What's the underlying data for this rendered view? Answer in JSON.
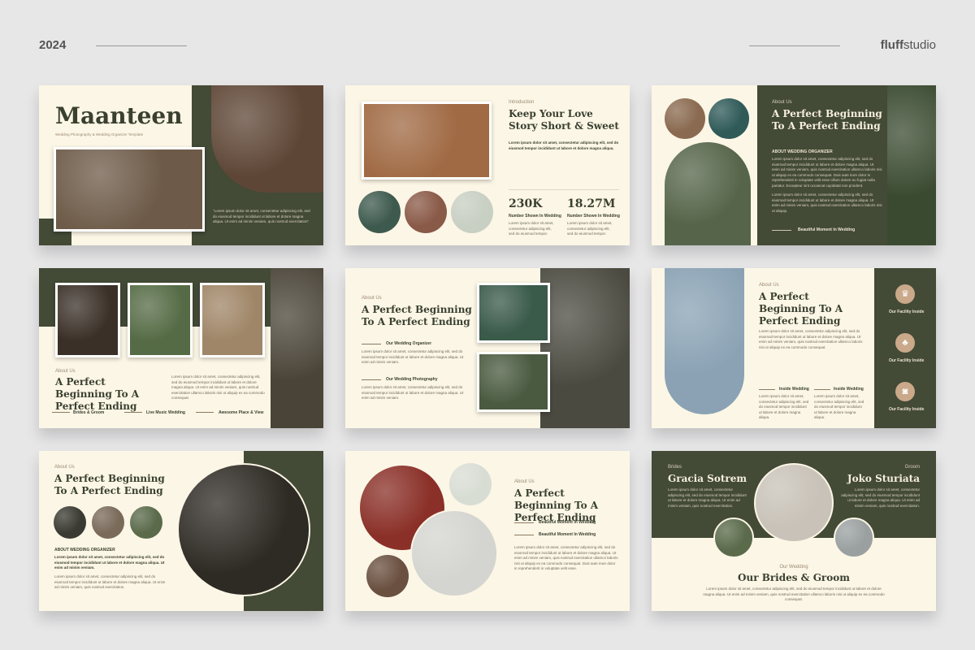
{
  "header": {
    "year": "2024",
    "brand_bold": "fluff",
    "brand_rest": "studio"
  },
  "s1": {
    "title": "Maanteen",
    "subtitle": "Wedding Photography & Wedding Organizer Template",
    "quote": "\"Lorem ipsum dolor sit amet, consectetur adipiscing elit, sed do eiusmod tempor incididunt ut labore et dolore magna aliqua. Ut enim ad minim veniam, quis nostrud exercitation\""
  },
  "s2": {
    "kicker": "Introduction",
    "title": "Keep Your Love Story Short & Sweet",
    "lead": "Lorem ipsum dolor sit amet, consectetur adipiscing elit, sed do eiusmod tempor incididunt ut labore et dolore magna aliqua.",
    "stat1_value": "230K",
    "stat1_label": "Number Shown In Wedding",
    "stat2_value": "18.27M",
    "stat2_label": "Number Shown In Wedding",
    "body": "Lorem ipsum dolor sit amet, consectetur adipiscing elit, sed do eiusmod tempor."
  },
  "s3": {
    "kicker": "About Us",
    "title": "A Perfect Beginning To A Perfect Ending",
    "section": "ABOUT WEDDING ORGANIZER",
    "body": "Lorem ipsum dolor sit amet, consectetur adipiscing elit, sed do eiusmod tempor incididunt ut labore et dolore magna aliqua. Ut enim ad minim veniam, quis nostrud exercitation ullamco laboris nisi ut aliquip ex ea commodo consequat. Duis aute irure dolor in reprehenderit in voluptate velit esse cillum dolore eu fugiat nulla pariatur. Excepteur sint occaecat cupidatat non proident.",
    "body2": "Lorem ipsum dolor sit amet, consectetur adipiscing elit, sed do eiusmod tempor incididunt ut labore et dolore magna aliqua. Ut enim ad minim veniam, quis nostrud exercitation ullamco laboris nisi ut aliquip.",
    "footer": "Beautiful Moment In Wedding"
  },
  "s4": {
    "kicker": "About Us",
    "title": "A Perfect Beginning To A Perfect Ending",
    "body": "Lorem ipsum dolor sit amet, consectetur adipiscing elit, sed do eiusmod tempor incididunt ut labore et dolore magna aliqua. Ut enim ad minim veniam, quis nostrud exercitation ullamco laboris nisi ut aliquip ex ea commodo consequat.",
    "label1": "Brides & Groom",
    "label2": "Live Music Wedding",
    "label3": "Awesome Place & View"
  },
  "s5": {
    "kicker": "About Us",
    "title": "A Perfect Beginning To A Perfect Ending",
    "label1": "Our Wedding Organizer",
    "body1": "Lorem ipsum dolor sit amet, consectetur adipiscing elit, sed do eiusmod tempor incididunt ut labore et dolore magna aliqua. Ut enim ad minim veniam.",
    "label2": "Our Wedding Photography",
    "body2": "Lorem ipsum dolor sit amet, consectetur adipiscing elit, sed do eiusmod tempor incididunt ut labore et dolore magna aliqua. Ut enim ad minim veniam."
  },
  "s6": {
    "kicker": "About Us",
    "title": "A Perfect Beginning To A Perfect Ending",
    "body": "Lorem ipsum dolor sit amet, consectetur adipiscing elit, sed do eiusmod tempor incididunt ut labore et dolore magna aliqua. Ut enim ad minim veniam, quis nostrud exercitation ullamco laboris nisi ut aliquip ex ea commodo consequat.",
    "col1_label": "Inside Wedding",
    "col1_body": "Lorem ipsum dolor sit amet, consectetur adipiscing elit, sed do eiusmod tempor incididunt ut labore et dolore magna aliqua.",
    "col2_label": "Inside Wedding",
    "col2_body": "Lorem ipsum dolor sit amet, consectetur adipiscing elit, sed do eiusmod tempor incididunt ut labore et dolore magna aliqua.",
    "facility1": "Our Facility Inside",
    "facility2": "Our Facility Inside",
    "facility3": "Our Facility Inside"
  },
  "s7": {
    "kicker": "About Us",
    "title": "A Perfect Beginning To A Perfect Ending",
    "section": "ABOUT WEDDING ORGANIZER",
    "body": "Lorem ipsum dolor sit amet, consectetur adipiscing elit, sed do eiusmod tempor incididunt ut labore et dolore magna aliqua. Ut enim ad minim veniam.",
    "body2": "Lorem ipsum dolor sit amet, consectetur adipiscing elit, sed do eiusmod tempor incididunt ut labore et dolore magna aliqua. Ut enim ad minim veniam, quis nostrud exercitation."
  },
  "s8": {
    "kicker": "About Us",
    "title": "A Perfect Beginning To A Perfect Ending",
    "label1": "Beautiful Moment In Wedding",
    "label2": "Beautiful Moment In Wedding",
    "body": "Lorem ipsum dolor sit amet, consectetur adipiscing elit, sed do eiusmod tempor incididunt ut labore et dolore magna aliqua. Ut enim ad minim veniam, quis nostrud exercitation ullamco laboris nisi ut aliquip ex ea commodo consequat. Duis aute irure dolor in reprehenderit in voluptate velit esse."
  },
  "s9": {
    "bride_kicker": "Brides",
    "bride_name": "Gracia Sotrem",
    "bride_body": "Lorem ipsum dolor sit amet, consectetur adipiscing elit, sed do eiusmod tempor incididunt ut labore et dolore magna aliqua. Ut enim ad minim veniam, quis nostrud exercitation.",
    "groom_kicker": "Groom",
    "groom_name": "Joko Sturiata",
    "groom_body": "Lorem ipsum dolor sit amet, consectetur adipiscing elit, sed do eiusmod tempor incididunt ut labore et dolore magna aliqua. Ut enim ad minim veniam, quis nostrud exercitation.",
    "kicker": "Our Wedding",
    "title": "Our Brides & Groom",
    "body": "Lorem ipsum dolor sit amet, consectetur adipiscing elit, sed do eiusmod tempor incididunt ut labore et dolore magna aliqua. Ut enim ad minim veniam, quis nostrud exercitation ullamco laboris nisi ut aliquip ex ea commodo consequat."
  },
  "icons": {
    "facility1": "suit-icon",
    "facility2": "people-icon",
    "facility3": "camera-icon"
  },
  "colors": {
    "dark": "#434a36",
    "cream": "#fcf6e6",
    "accent": "#c9a98a"
  }
}
